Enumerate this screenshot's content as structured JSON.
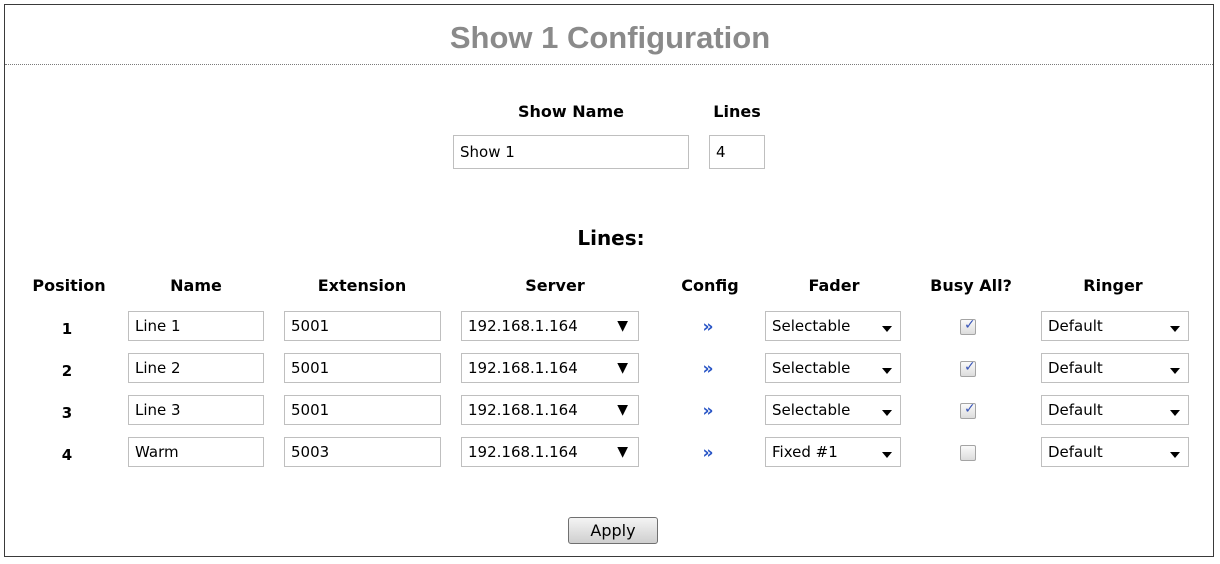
{
  "page": {
    "title": "Show 1 Configuration"
  },
  "show": {
    "name_label": "Show Name",
    "name_value": "Show 1",
    "lines_label": "Lines",
    "lines_value": "4"
  },
  "lines_section": {
    "heading": "Lines:"
  },
  "table": {
    "headers": {
      "position": "Position",
      "name": "Name",
      "extension": "Extension",
      "server": "Server",
      "config": "Config",
      "fader": "Fader",
      "busy_all": "Busy All?",
      "ringer": "Ringer"
    },
    "rows": [
      {
        "position": "1",
        "name": "Line 1",
        "extension": "5001",
        "server": "192.168.1.164",
        "config": "»",
        "fader": "Selectable",
        "busy_all": true,
        "ringer": "Default"
      },
      {
        "position": "2",
        "name": "Line 2",
        "extension": "5001",
        "server": "192.168.1.164",
        "config": "»",
        "fader": "Selectable",
        "busy_all": true,
        "ringer": "Default"
      },
      {
        "position": "3",
        "name": "Line 3",
        "extension": "5001",
        "server": "192.168.1.164",
        "config": "»",
        "fader": "Selectable",
        "busy_all": true,
        "ringer": "Default"
      },
      {
        "position": "4",
        "name": "Warm",
        "extension": "5003",
        "server": "192.168.1.164",
        "config": "»",
        "fader": "Fixed #1",
        "busy_all": false,
        "ringer": "Default"
      }
    ]
  },
  "actions": {
    "apply_label": "Apply"
  },
  "icons": {
    "checkmark": "checkmark-icon",
    "server_arrow": "triangle-down-icon",
    "dropdown_arrow": "caret-down-icon"
  },
  "colors": {
    "title": "#8a8a8a",
    "config_link": "#2a56c6",
    "check": "#3b57b8"
  }
}
